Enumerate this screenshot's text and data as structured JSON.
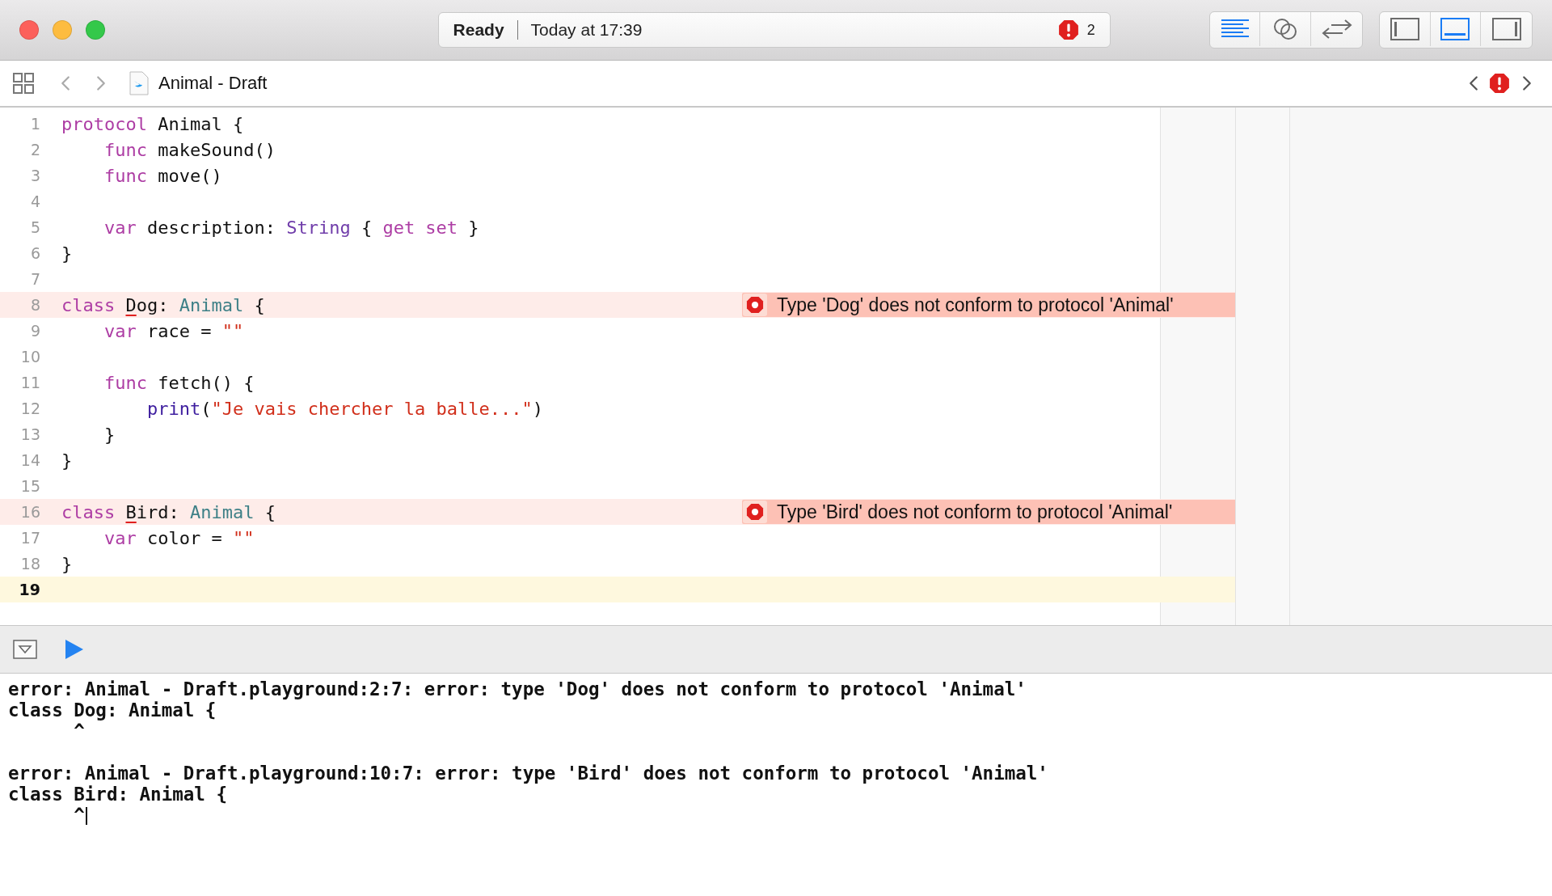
{
  "window": {
    "status": "Ready",
    "timestamp": "Today at 17:39",
    "issue_count": "2"
  },
  "editor_modes": [
    {
      "kind": "standard",
      "selected": true
    },
    {
      "kind": "assistant",
      "selected": false
    },
    {
      "kind": "version",
      "selected": false
    }
  ],
  "panels": [
    {
      "kind": "navigator",
      "selected": false
    },
    {
      "kind": "debug",
      "selected": true
    },
    {
      "kind": "inspector",
      "selected": false
    }
  ],
  "nav": {
    "file": "Animal - Draft"
  },
  "editor": {
    "lines": [
      {
        "number": "1",
        "current": false,
        "tokens": [
          {
            "kind": "keyword",
            "text": "protocol"
          },
          {
            "kind": "plain",
            "text": " Animal {"
          }
        ]
      },
      {
        "number": "2",
        "current": false,
        "tokens": [
          {
            "kind": "keyword",
            "text": "    func"
          },
          {
            "kind": "plain",
            "text": " makeSound()"
          }
        ]
      },
      {
        "number": "3",
        "current": false,
        "tokens": [
          {
            "kind": "keyword",
            "text": "    func"
          },
          {
            "kind": "plain",
            "text": " move()"
          }
        ]
      },
      {
        "number": "4",
        "current": false
      },
      {
        "number": "5",
        "current": false,
        "tokens": [
          {
            "kind": "keyword",
            "text": "    var"
          },
          {
            "kind": "plain",
            "text": " description: "
          },
          {
            "kind": "system-type",
            "text": "String"
          },
          {
            "kind": "plain",
            "text": " { "
          },
          {
            "kind": "keyword",
            "text": "get set"
          },
          {
            "kind": "plain",
            "text": " }"
          }
        ]
      },
      {
        "number": "6",
        "current": false,
        "tokens": [
          {
            "kind": "plain",
            "text": "}"
          }
        ]
      },
      {
        "number": "7",
        "current": false
      },
      {
        "number": "8",
        "current": false,
        "tokens": [
          {
            "kind": "keyword",
            "text": "class"
          },
          {
            "kind": "error-mark",
            "text": "D"
          },
          {
            "kind": "plain",
            "text": "og: "
          },
          {
            "kind": "project-type",
            "text": "Animal"
          },
          {
            "kind": "plain",
            "text": " {"
          }
        ],
        "error": "Type 'Dog' does not conform to protocol 'Animal'"
      },
      {
        "number": "9",
        "current": false,
        "tokens": [
          {
            "kind": "keyword",
            "text": "    var"
          },
          {
            "kind": "plain",
            "text": " race = "
          },
          {
            "kind": "string",
            "text": "\"\""
          }
        ]
      },
      {
        "number": "10",
        "current": false
      },
      {
        "number": "11",
        "current": false,
        "tokens": [
          {
            "kind": "keyword",
            "text": "    func"
          },
          {
            "kind": "plain",
            "text": " fetch() {"
          }
        ]
      },
      {
        "number": "12",
        "current": false,
        "tokens": [
          {
            "kind": "call",
            "text": "        print"
          },
          {
            "kind": "plain",
            "text": "("
          },
          {
            "kind": "string",
            "text": "\"Je vais chercher la balle...\""
          },
          {
            "kind": "plain",
            "text": ")"
          }
        ]
      },
      {
        "number": "13",
        "current": false,
        "tokens": [
          {
            "kind": "plain",
            "text": "    }"
          }
        ]
      },
      {
        "number": "14",
        "current": false,
        "tokens": [
          {
            "kind": "plain",
            "text": "}"
          }
        ]
      },
      {
        "number": "15",
        "current": false
      },
      {
        "number": "16",
        "current": false,
        "tokens": [
          {
            "kind": "keyword",
            "text": "class"
          },
          {
            "kind": "error-mark",
            "text": "B"
          },
          {
            "kind": "plain",
            "text": "ird: "
          },
          {
            "kind": "project-type",
            "text": "Animal"
          },
          {
            "kind": "plain",
            "text": " {"
          }
        ],
        "error": "Type 'Bird' does not conform to protocol 'Animal'"
      },
      {
        "number": "17",
        "current": false,
        "tokens": [
          {
            "kind": "keyword",
            "text": "    var"
          },
          {
            "kind": "plain",
            "text": " color = "
          },
          {
            "kind": "string",
            "text": "\"\""
          }
        ]
      },
      {
        "number": "18",
        "current": false,
        "tokens": [
          {
            "kind": "plain",
            "text": "}"
          }
        ]
      },
      {
        "number": "19",
        "current": true
      }
    ]
  },
  "console": {
    "entries": [
      {
        "message": "error: Animal - Draft.playground:2:7: error: type 'Dog' does not conform to protocol 'Animal'",
        "source": "class Dog: Animal {",
        "marker": "^",
        "has_cursor": false
      },
      {
        "message": "error: Animal - Draft.playground:10:7: error: type 'Bird' does not conform to protocol 'Animal'",
        "source": "class Bird: Animal {",
        "marker": "^",
        "has_cursor": true
      }
    ]
  }
}
